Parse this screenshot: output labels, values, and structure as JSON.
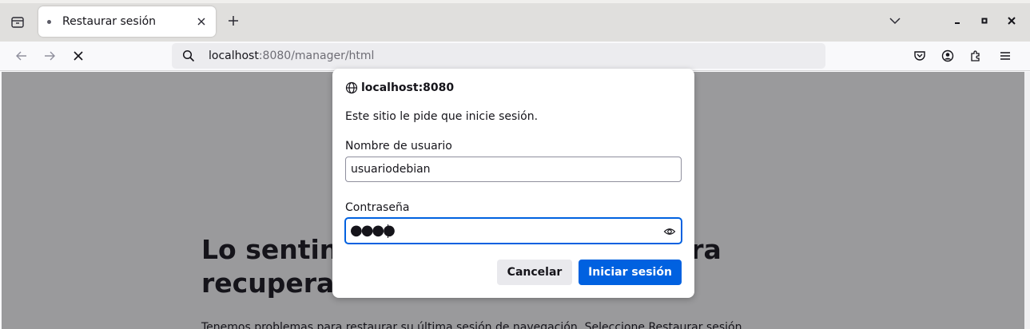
{
  "tab": {
    "title": "Restaurar sesión"
  },
  "urlbar": {
    "host": "localhost",
    "rest": ":8080/manager/html"
  },
  "page": {
    "heading": "Lo sentimos. Estamos teniendo problemas para recuperar sus páginas.",
    "heading_visible_left": "Lo sentin",
    "heading_visible_right": "para",
    "heading_line2_left": "recupera",
    "paragraph": "Tenemos problemas para restaurar su última sesión de navegación. Seleccione Restaurar sesión"
  },
  "dialog": {
    "host": "localhost:8080",
    "message": "Este sitio le pide que inicie sesión.",
    "username_label": "Nombre de usuario",
    "username_value": "usuariodebian",
    "password_label": "Contraseña",
    "password_mask": "●●●●",
    "cancel_label": "Cancelar",
    "login_label": "Iniciar sesión"
  },
  "icons": {
    "tab_list": "tab-list-icon",
    "new_tab": "plus-icon",
    "list_all_tabs": "chevron-down-icon",
    "minimize": "minimize-icon",
    "maximize": "maximize-icon",
    "close_window": "close-icon",
    "back": "arrow-left-icon",
    "forward": "arrow-right-icon",
    "stop": "stop-icon",
    "search": "search-icon",
    "pocket": "pocket-icon",
    "account": "account-icon",
    "extensions": "puzzle-icon",
    "menu": "hamburger-menu-icon",
    "globe": "globe-icon",
    "reveal_password": "eye-icon"
  },
  "colors": {
    "accent": "#0061e0",
    "overlay": "#9a9a9c",
    "toolbar": "#f9f9fb",
    "tabstrip": "#e0dfdd"
  }
}
